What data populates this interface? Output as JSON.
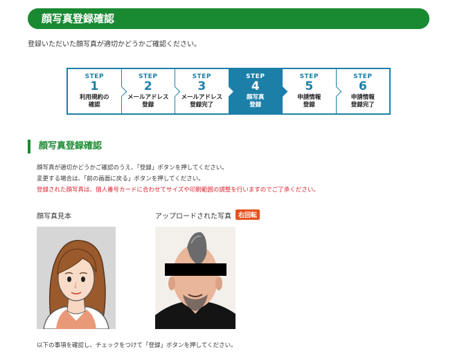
{
  "header": {
    "title": "顔写真登録確認"
  },
  "intro": "登録いただいた顔写真が適切かどうかご確認ください。",
  "steps": [
    {
      "label": "STEP",
      "num": "1",
      "name1": "利用規約の",
      "name2": "確認",
      "active": false
    },
    {
      "label": "STEP",
      "num": "2",
      "name1": "メールアドレス",
      "name2": "登録",
      "active": false
    },
    {
      "label": "STEP",
      "num": "3",
      "name1": "メールアドレス",
      "name2": "登録完了",
      "active": false
    },
    {
      "label": "STEP",
      "num": "4",
      "name1": "顔写真",
      "name2": "登録",
      "active": true
    },
    {
      "label": "STEP",
      "num": "5",
      "name1": "申請情報",
      "name2": "登録",
      "active": false
    },
    {
      "label": "STEP",
      "num": "6",
      "name1": "申請情報",
      "name2": "登録完了",
      "active": false
    }
  ],
  "section": {
    "title": "顔写真登録確認",
    "line1": "顔写真が適切かどうかご確認のうえ、「登録」ボタンを押してください。",
    "line2": "変更する場合は、「前の画面に戻る」ボタンを押してください。",
    "line3": "登録された顔写真は、個人番号カードに合わせてサイズや印刷範囲の調整を行いますのでご了承ください。"
  },
  "photos": {
    "sample_caption": "顔写真見本",
    "upload_caption": "アップロードされた写真",
    "rotate_label": "右回転"
  },
  "footer_text": "以下の事項を確認し、チェックをつけて「登録」ボタンを押してください。",
  "colors": {
    "green": "#1a8a32",
    "blue": "#1b7fa8",
    "red": "#d9232e",
    "badge": "#e8501d"
  }
}
